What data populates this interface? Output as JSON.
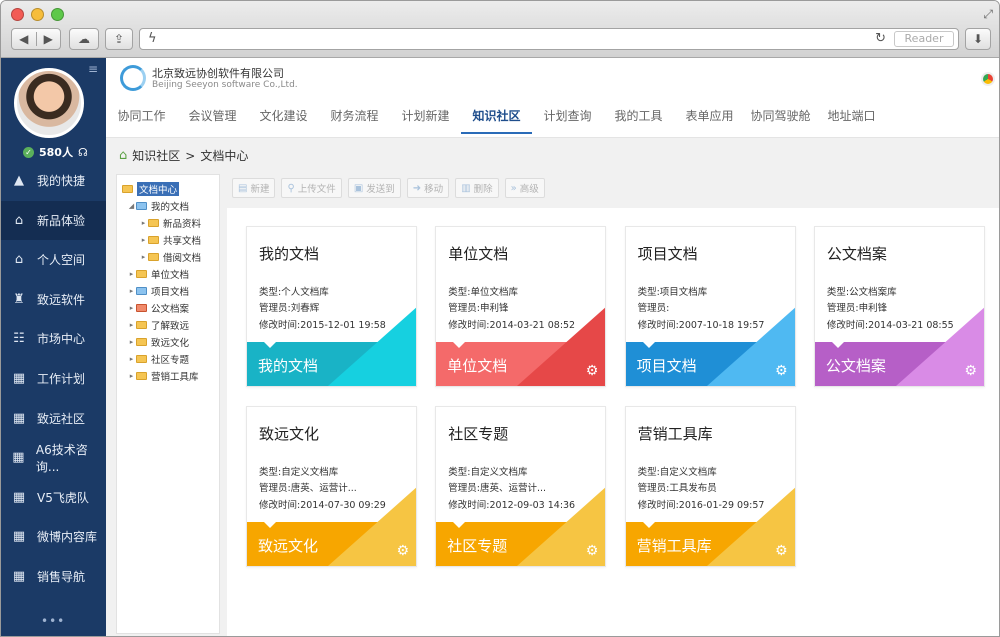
{
  "browser": {
    "reader_label": "Reader"
  },
  "sidebar": {
    "followers": "580人",
    "items": [
      {
        "label": "我的快捷",
        "icon": "triangle-icon"
      },
      {
        "label": "新品体验",
        "icon": "home-icon"
      },
      {
        "label": "个人空间",
        "icon": "house-outline-icon"
      },
      {
        "label": "致远软件",
        "icon": "chair-icon"
      },
      {
        "label": "市场中心",
        "icon": "people-icon"
      },
      {
        "label": "工作计划",
        "icon": "building-icon"
      },
      {
        "label": "致远社区",
        "icon": "building-icon"
      },
      {
        "label": "A6技术咨询...",
        "icon": "building-icon"
      },
      {
        "label": "V5飞虎队",
        "icon": "building-icon"
      },
      {
        "label": "微博内容库",
        "icon": "building-icon"
      },
      {
        "label": "销售导航",
        "icon": "building-icon"
      }
    ]
  },
  "header": {
    "company": "北京致远协创软件有限公司",
    "company_en": "Beijing Seeyon software Co.,Ltd.",
    "tabs": [
      "协同工作",
      "会议管理",
      "文化建设",
      "财务流程",
      "计划新建",
      "知识社区",
      "计划查询",
      "我的工具",
      "表单应用",
      "协同驾驶舱",
      "地址端口"
    ],
    "active_tab": "知识社区"
  },
  "breadcrumb": {
    "root": "知识社区",
    "separator": ">",
    "current": "文档中心"
  },
  "tree": {
    "root": "文档中心",
    "nodes": [
      {
        "label": "我的文档",
        "level": 1,
        "expanded": true,
        "color": "blue"
      },
      {
        "label": "新品资料",
        "level": 2,
        "color": "yellow"
      },
      {
        "label": "共享文档",
        "level": 2,
        "color": "yellow"
      },
      {
        "label": "借阅文档",
        "level": 2,
        "color": "yellow"
      },
      {
        "label": "单位文档",
        "level": 1,
        "color": "yellow"
      },
      {
        "label": "项目文档",
        "level": 1,
        "color": "blue"
      },
      {
        "label": "公文档案",
        "level": 1,
        "color": "red"
      },
      {
        "label": "了解致远",
        "level": 1,
        "color": "yellow"
      },
      {
        "label": "致远文化",
        "level": 1,
        "color": "yellow"
      },
      {
        "label": "社区专题",
        "level": 1,
        "color": "yellow"
      },
      {
        "label": "营销工具库",
        "level": 1,
        "color": "yellow"
      }
    ]
  },
  "toolbar": {
    "buttons": [
      {
        "label": "新建",
        "icon": "new-doc-icon"
      },
      {
        "label": "上传文件",
        "icon": "paperclip-icon"
      },
      {
        "label": "发送到",
        "icon": "image-icon"
      },
      {
        "label": "移动",
        "icon": "move-icon"
      },
      {
        "label": "删除",
        "icon": "trash-icon"
      },
      {
        "label": "高级",
        "icon": "advanced-icon"
      }
    ]
  },
  "cards": [
    {
      "title": "我的文档",
      "type": "类型:个人文档库",
      "manager": "管理员:刘春辉",
      "modified": "修改时间:2015-12-01 19:58",
      "band": "我的文档",
      "color": "#19b3c6",
      "color2": "#16d0e0",
      "gear": false
    },
    {
      "title": "单位文档",
      "type": "类型:单位文档库",
      "manager": "管理员:申利锋",
      "modified": "修改时间:2014-03-21 08:52",
      "band": "单位文档",
      "color": "#f46a6a",
      "color2": "#e64848",
      "gear": true
    },
    {
      "title": "项目文档",
      "type": "类型:项目文档库",
      "manager": "管理员:",
      "modified": "修改时间:2007-10-18 19:57",
      "band": "项目文档",
      "color": "#1f8fd6",
      "color2": "#4fb9f2",
      "gear": true
    },
    {
      "title": "公文档案",
      "type": "类型:公文档案库",
      "manager": "管理员:申利锋",
      "modified": "修改时间:2014-03-21 08:55",
      "band": "公文档案",
      "color": "#b65fc7",
      "color2": "#d98be6",
      "gear": true
    },
    {
      "title": "致远文化",
      "type": "类型:自定义文档库",
      "manager": "管理员:唐英、运营计...",
      "modified": "修改时间:2014-07-30 09:29",
      "band": "致远文化",
      "color": "#f7a600",
      "color2": "#f6c543",
      "gear": true
    },
    {
      "title": "社区专题",
      "type": "类型:自定义文档库",
      "manager": "管理员:唐英、运营计...",
      "modified": "修改时间:2012-09-03 14:36",
      "band": "社区专题",
      "color": "#f7a600",
      "color2": "#f6c543",
      "gear": true
    },
    {
      "title": "营销工具库",
      "type": "类型:自定义文档库",
      "manager": "管理员:工具发布员",
      "modified": "修改时间:2016-01-29 09:57",
      "band": "营销工具库",
      "color": "#f7a600",
      "color2": "#f6c543",
      "gear": true
    }
  ]
}
